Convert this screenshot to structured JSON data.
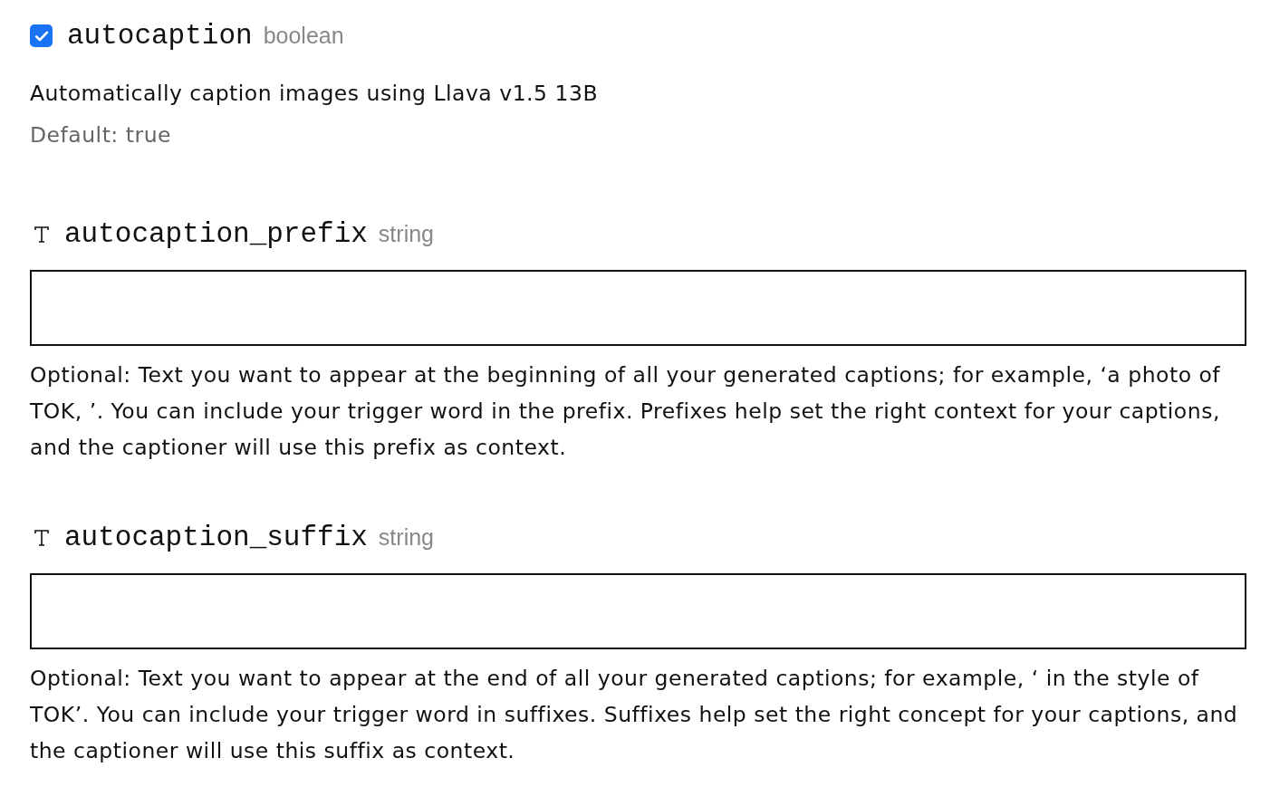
{
  "fields": [
    {
      "kind": "boolean",
      "name": "autocaption",
      "type": "boolean",
      "checked": true,
      "description": "Automatically caption images using Llava v1.5 13B",
      "default": "Default: true"
    },
    {
      "kind": "string",
      "name": "autocaption_prefix",
      "type": "string",
      "description": "Optional: Text you want to appear at the beginning of all your generated captions; for example, ‘a photo of TOK, ’. You can include your trigger word in the prefix. Prefixes help set the right context for your captions, and the captioner will use this prefix as context."
    },
    {
      "kind": "string",
      "name": "autocaption_suffix",
      "type": "string",
      "description": "Optional: Text you want to appear at the end of all your generated captions; for example, ‘ in the style of TOK’. You can include your trigger word in suffixes. Suffixes help set the right concept for your captions, and the captioner will use this suffix as context."
    }
  ]
}
